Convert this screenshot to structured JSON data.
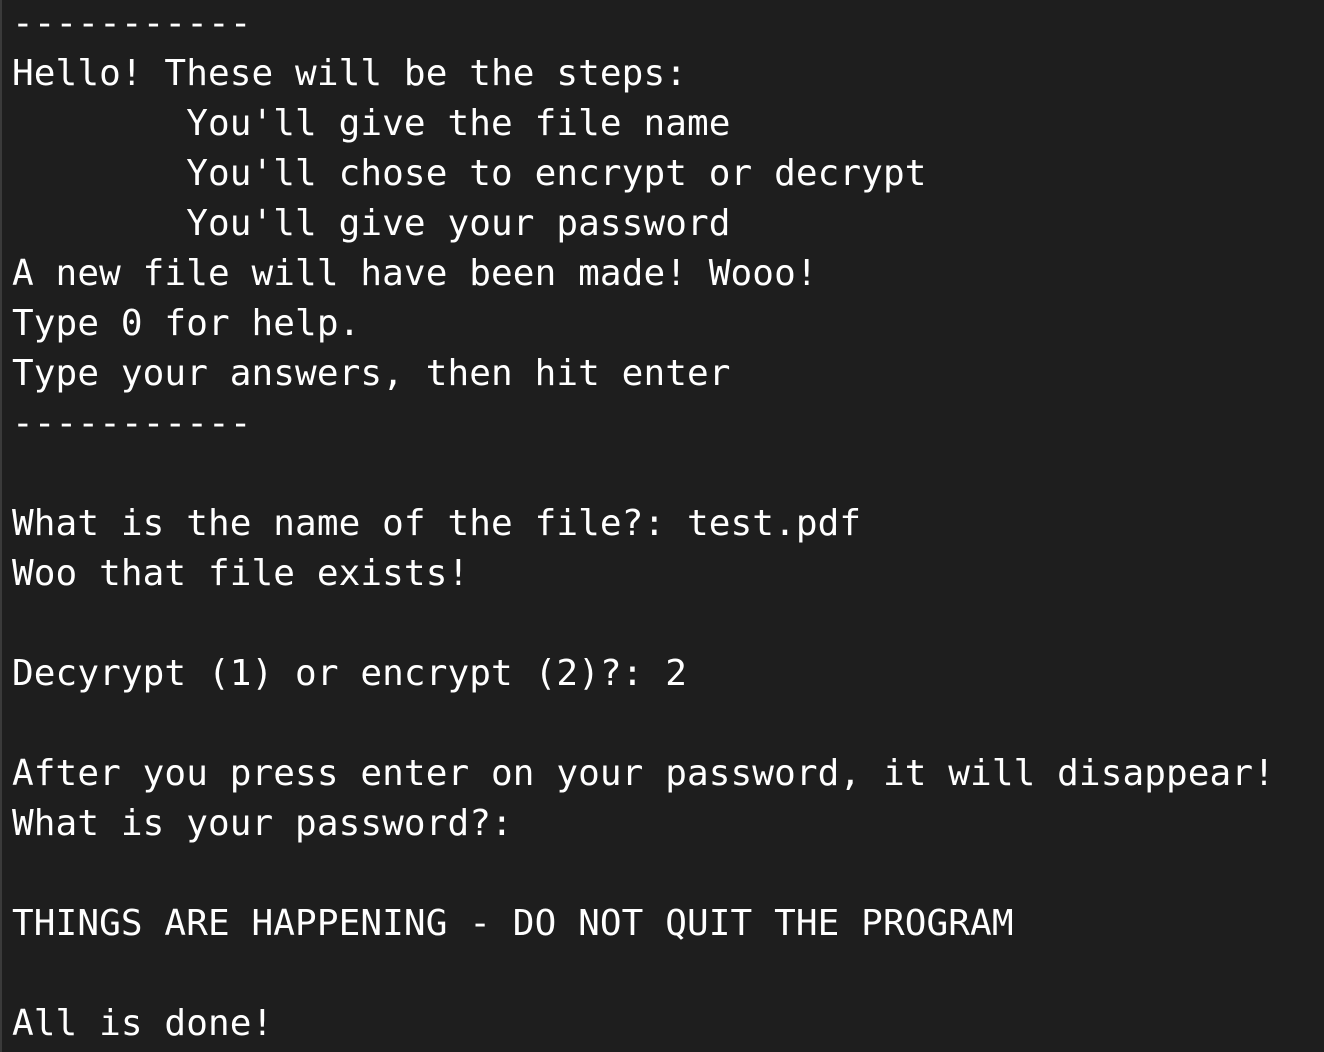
{
  "terminal": {
    "lines": [
      "-----------",
      "Hello! These will be the steps:",
      "        You'll give the file name",
      "        You'll chose to encrypt or decrypt",
      "        You'll give your password",
      "A new file will have been made! Wooo!",
      "Type 0 for help.",
      "Type your answers, then hit enter",
      "-----------",
      "What is the name of the file?: test.pdf",
      "Woo that file exists!",
      "Decyrypt (1) or encrypt (2)?: 2",
      "After you press enter on your password, it will disappear!",
      "What is your password?:",
      "THINGS ARE HAPPENING - DO NOT QUIT THE PROGRAM",
      "All is done!"
    ]
  }
}
